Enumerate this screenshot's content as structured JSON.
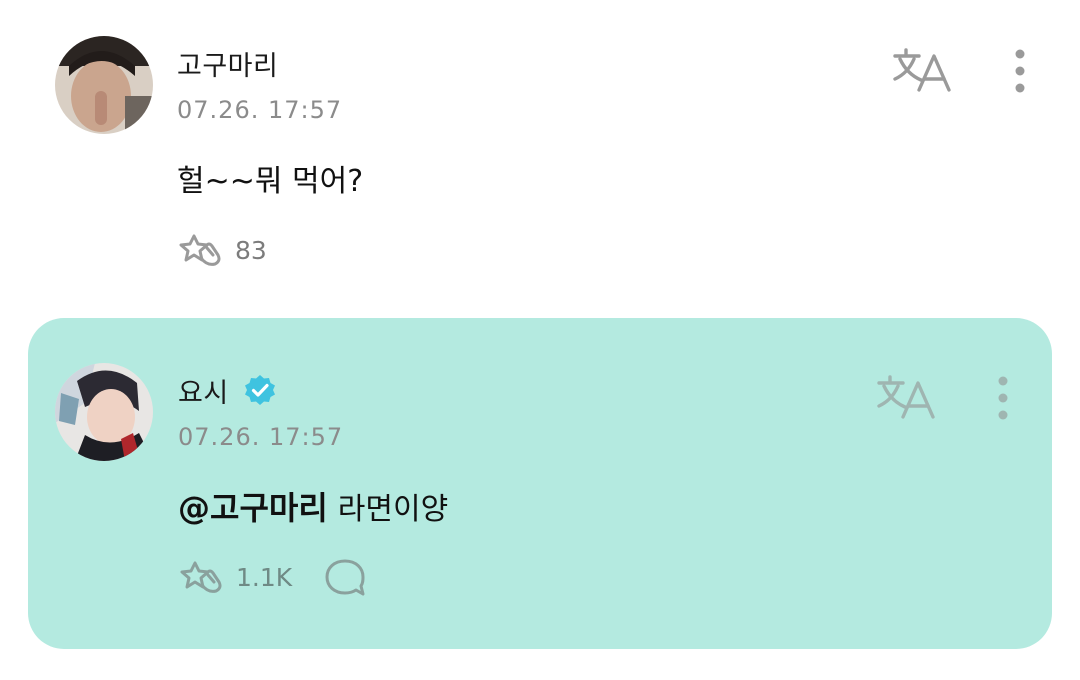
{
  "comments": [
    {
      "author": "고구마리",
      "timestamp": "07.26. 17:57",
      "text": "헐~~뭐 먹어?",
      "likes": "83"
    },
    {
      "author": "요시",
      "verified": true,
      "timestamp": "07.26. 17:57",
      "mention": "@고구마리",
      "text": "라면이양",
      "likes": "1.1K",
      "highlight_color": "#b4eae0"
    }
  ],
  "icons": {
    "translate": "translate-icon",
    "more": "more-vertical-icon",
    "like": "star-hand-icon",
    "reply": "speech-bubble-icon",
    "verified": "verified-badge-icon"
  },
  "colors": {
    "verified_badge": "#3fc3e0",
    "icon_gray": "#9a9a9a"
  }
}
